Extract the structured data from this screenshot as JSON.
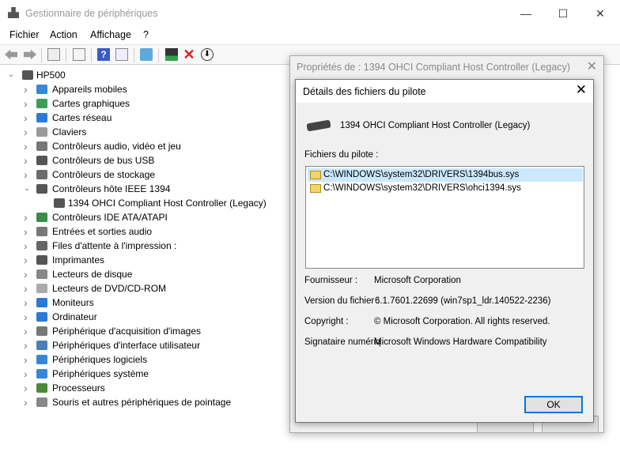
{
  "window": {
    "title": "Gestionnaire de périphériques",
    "minimize": "—",
    "maximize": "☐",
    "close": "✕"
  },
  "menu": [
    "Fichier",
    "Action",
    "Affichage",
    "?"
  ],
  "toolbar_icons": [
    "back-icon",
    "forward-icon",
    "show-hide-tree-icon",
    "properties-icon",
    "help-icon",
    "action-pane-icon",
    "scan-hardware-icon",
    "update-driver-icon",
    "uninstall-icon",
    "disable-icon"
  ],
  "tree": {
    "root": "HP500",
    "items": [
      {
        "label": "Appareils mobiles",
        "expanded": false,
        "color": "#3a86d6"
      },
      {
        "label": "Cartes graphiques",
        "expanded": false,
        "color": "#3d9c5a"
      },
      {
        "label": "Cartes réseau",
        "expanded": false,
        "color": "#2b7bd6"
      },
      {
        "label": "Claviers",
        "expanded": false,
        "color": "#9a9a9a"
      },
      {
        "label": "Contrôleurs audio, vidéo et jeu",
        "expanded": false,
        "color": "#777"
      },
      {
        "label": "Contrôleurs de bus USB",
        "expanded": false,
        "color": "#555"
      },
      {
        "label": "Contrôleurs de stockage",
        "expanded": false,
        "color": "#6b6b6b"
      },
      {
        "label": "Contrôleurs hôte IEEE 1394",
        "expanded": true,
        "color": "#555"
      },
      {
        "label": "1394 OHCI Compliant Host Controller (Legacy)",
        "child": true,
        "color": "#555"
      },
      {
        "label": "Contrôleurs IDE ATA/ATAPI",
        "expanded": false,
        "color": "#3d8a4a"
      },
      {
        "label": "Entrées et sorties audio",
        "expanded": false,
        "color": "#777"
      },
      {
        "label": "Files d'attente à l'impression :",
        "expanded": false,
        "color": "#666"
      },
      {
        "label": "Imprimantes",
        "expanded": false,
        "color": "#555"
      },
      {
        "label": "Lecteurs de disque",
        "expanded": false,
        "color": "#888"
      },
      {
        "label": "Lecteurs de DVD/CD-ROM",
        "expanded": false,
        "color": "#aaa"
      },
      {
        "label": "Moniteurs",
        "expanded": false,
        "color": "#2b7bd6"
      },
      {
        "label": "Ordinateur",
        "expanded": false,
        "color": "#2b7bd6"
      },
      {
        "label": "Périphérique d'acquisition d'images",
        "expanded": false,
        "color": "#777"
      },
      {
        "label": "Périphériques d'interface utilisateur",
        "expanded": false,
        "color": "#4a7fb5"
      },
      {
        "label": "Périphériques logiciels",
        "expanded": false,
        "color": "#3a86d6"
      },
      {
        "label": "Périphériques système",
        "expanded": false,
        "color": "#3a86d6"
      },
      {
        "label": "Processeurs",
        "expanded": false,
        "color": "#4a8a3a"
      },
      {
        "label": "Souris et autres périphériques de pointage",
        "expanded": false,
        "color": "#888"
      }
    ]
  },
  "properties_dialog": {
    "title": "Propriétés de : 1394 OHCI Compliant Host Controller (Legacy)",
    "close": "✕"
  },
  "driver_details": {
    "title": "Détails des fichiers du pilote",
    "close": "✕",
    "device_name": "1394 OHCI Compliant Host Controller (Legacy)",
    "files_label": "Fichiers du pilote :",
    "files": [
      {
        "path": "C:\\WINDOWS\\system32\\DRIVERS\\1394bus.sys",
        "selected": true
      },
      {
        "path": "C:\\WINDOWS\\system32\\DRIVERS\\ohci1394.sys",
        "selected": false
      }
    ],
    "provider_label": "Fournisseur :",
    "provider": "Microsoft Corporation",
    "version_label": "Version du fichier :",
    "version": "6.1.7601.22699 (win7sp1_ldr.140522-2236)",
    "copyright_label": "Copyright :",
    "copyright": "© Microsoft Corporation. All rights reserved.",
    "signer_label": "Signataire numériq",
    "signer": "Microsoft Windows Hardware Compatibility",
    "ok": "OK"
  },
  "colors": {
    "selection": "#cce8ff",
    "accent": "#0078d7"
  }
}
